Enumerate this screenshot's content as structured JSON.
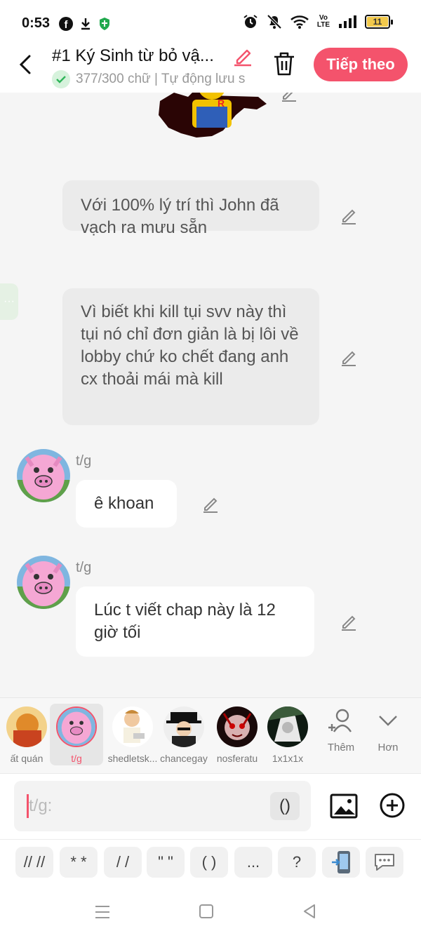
{
  "status_bar": {
    "time": "0:53",
    "volte_top": "Vo",
    "volte_bottom": "LTE",
    "battery": "11",
    "left_icons": [
      "facebook-icon",
      "download-icon",
      "shield-icon"
    ],
    "right_icons": [
      "alarm-icon",
      "mute-icon",
      "wifi-icon",
      "volte-icon",
      "signal-icon",
      "battery-icon"
    ]
  },
  "header": {
    "title": "#1 Ký Sinh từ bỏ vậ...",
    "subtitle": "377/300 chữ | Tự động lưu s",
    "next_button": "Tiếp theo",
    "accent": "#f4536c"
  },
  "messages": [
    {
      "type": "narration",
      "text": "Với 100% lý trí thì John đã vạch ra mưu sẵn"
    },
    {
      "type": "narration",
      "text": "Vì biết khi kill tụi svv này thì tụi nó chỉ đơn giản là bị lôi về lobby chứ ko chết đang anh cx thoải mái mà kill"
    },
    {
      "type": "dialogue",
      "sender": "t/g",
      "text": "ê khoan"
    },
    {
      "type": "dialogue",
      "sender": "t/g",
      "text": "Lúc t viết chap này là 12 giờ tối"
    }
  ],
  "characters": [
    {
      "name": "ất quán",
      "selected": false
    },
    {
      "name": "t/g",
      "selected": true
    },
    {
      "name": "shedletsk...",
      "selected": false
    },
    {
      "name": "chancegay",
      "selected": false
    },
    {
      "name": "nosferatu",
      "selected": false
    },
    {
      "name": "1x1x1x",
      "selected": false
    }
  ],
  "tools": {
    "add_label": "Thêm",
    "more_label": "Hơn"
  },
  "input": {
    "prefix": "t/g:",
    "paren_chip": "()"
  },
  "format_chips": [
    "// //",
    "* *",
    "/ /",
    "\" \"",
    "( )",
    "...",
    "?",
    "📲",
    "💬"
  ]
}
